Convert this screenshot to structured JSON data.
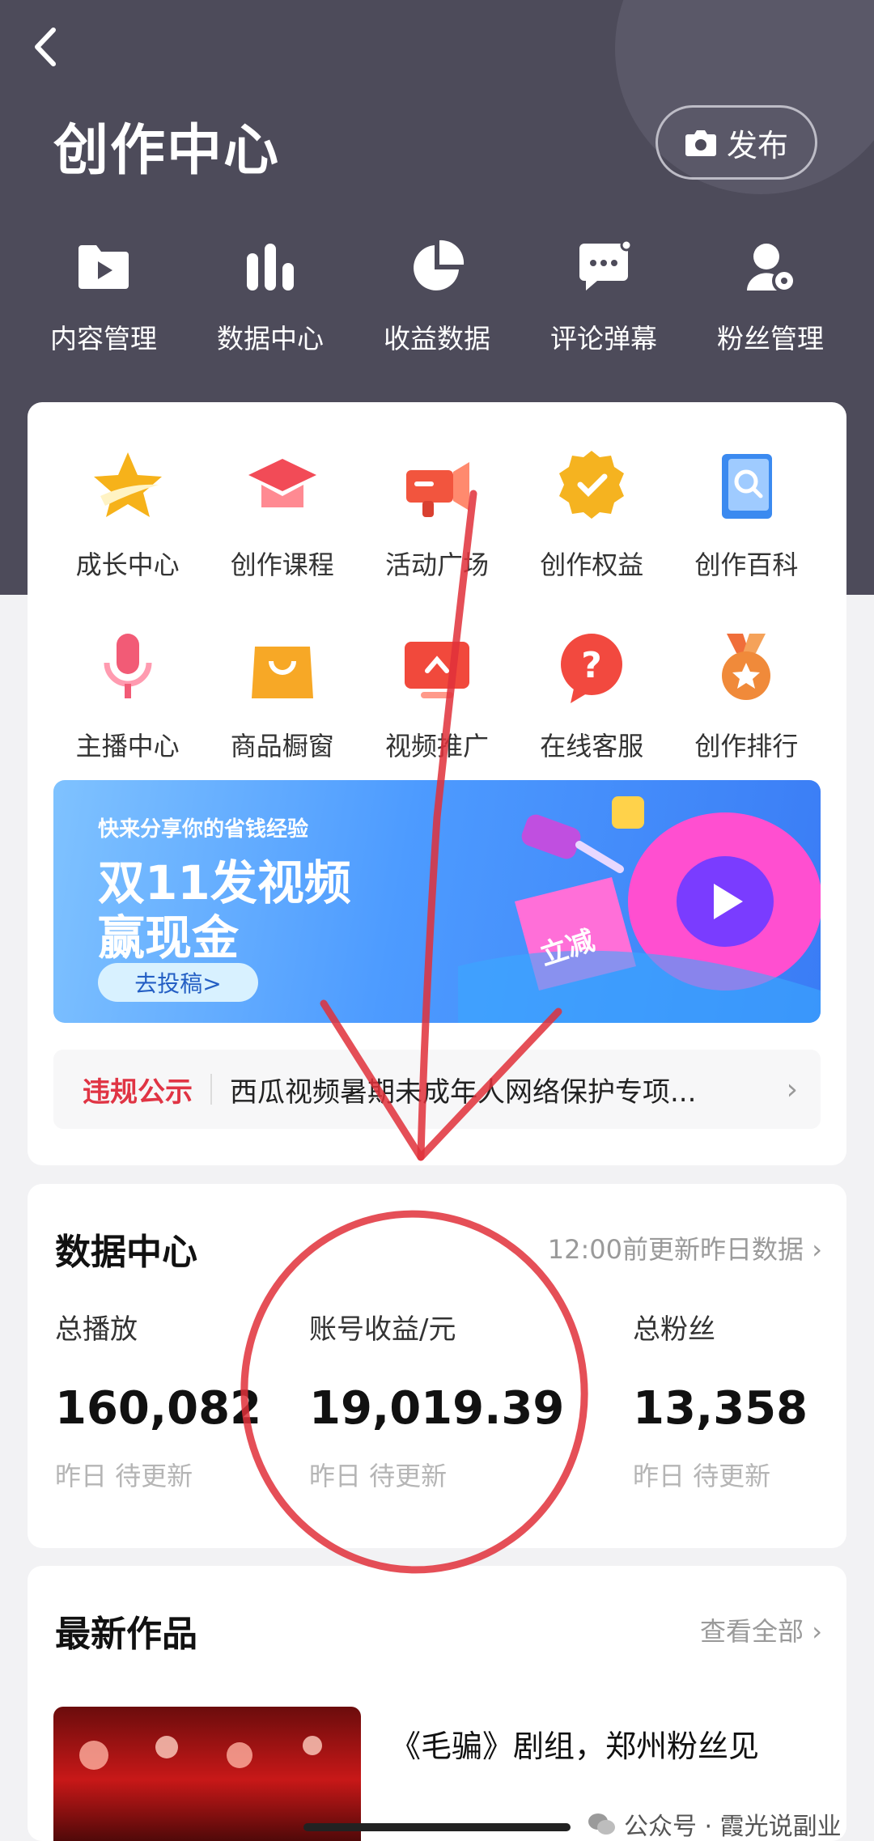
{
  "header": {
    "back_icon": "chevron-left-icon",
    "title": "创作中心",
    "publish_label": "发布",
    "publish_icon": "camera-icon"
  },
  "top_nav": [
    {
      "label": "内容管理",
      "icon": "folder-play-icon"
    },
    {
      "label": "数据中心",
      "icon": "bar-chart-icon"
    },
    {
      "label": "收益数据",
      "icon": "pie-chart-icon"
    },
    {
      "label": "评论弹幕",
      "icon": "comment-icon"
    },
    {
      "label": "粉丝管理",
      "icon": "fans-icon"
    }
  ],
  "tools": [
    {
      "label": "成长中心",
      "icon": "star-icon",
      "color": "#f6b21a"
    },
    {
      "label": "创作课程",
      "icon": "graduation-cap-icon",
      "color": "#f24b57"
    },
    {
      "label": "活动广场",
      "icon": "megaphone-icon",
      "color": "#f2553e"
    },
    {
      "label": "创作权益",
      "icon": "medal-icon",
      "color": "#f5b320"
    },
    {
      "label": "创作百科",
      "icon": "book-search-icon",
      "color": "#3b8af0"
    },
    {
      "label": "主播中心",
      "icon": "microphone-icon",
      "color": "#f25b76"
    },
    {
      "label": "商品橱窗",
      "icon": "shopping-bag-icon",
      "color": "#f7a826"
    },
    {
      "label": "视频推广",
      "icon": "video-promote-icon",
      "color": "#f1493c"
    },
    {
      "label": "在线客服",
      "icon": "help-bubble-icon",
      "color": "#f2493f"
    },
    {
      "label": "创作排行",
      "icon": "ranking-medal-icon",
      "color": "#f08a3a"
    }
  ],
  "banner": {
    "subtitle": "快来分享你的省钱经验",
    "line1": "双11发视频",
    "line2": "赢现金",
    "cta": "去投稿>",
    "tag_text": "立减"
  },
  "notice": {
    "tag": "违规公示",
    "text": "西瓜视频暑期未成年人网络保护专项..."
  },
  "data_center": {
    "title": "数据中心",
    "update_note": "12:00前更新昨日数据",
    "stats": [
      {
        "label": "总播放",
        "value": "160,082",
        "sub": "昨日 待更新"
      },
      {
        "label": "账号收益/元",
        "value": "19,019.39",
        "sub": "昨日 待更新"
      },
      {
        "label": "总粉丝",
        "value": "13,358",
        "sub": "昨日 待更新"
      }
    ]
  },
  "latest": {
    "title": "最新作品",
    "view_all": "查看全部",
    "work_title": "《毛骗》剧组，郑州粉丝见"
  },
  "watermark": "公众号 · 霞光说副业",
  "colors": {
    "hero_bg": "#4d4b5a",
    "accent_red": "#e03444",
    "annotation_red": "#e0303a"
  }
}
